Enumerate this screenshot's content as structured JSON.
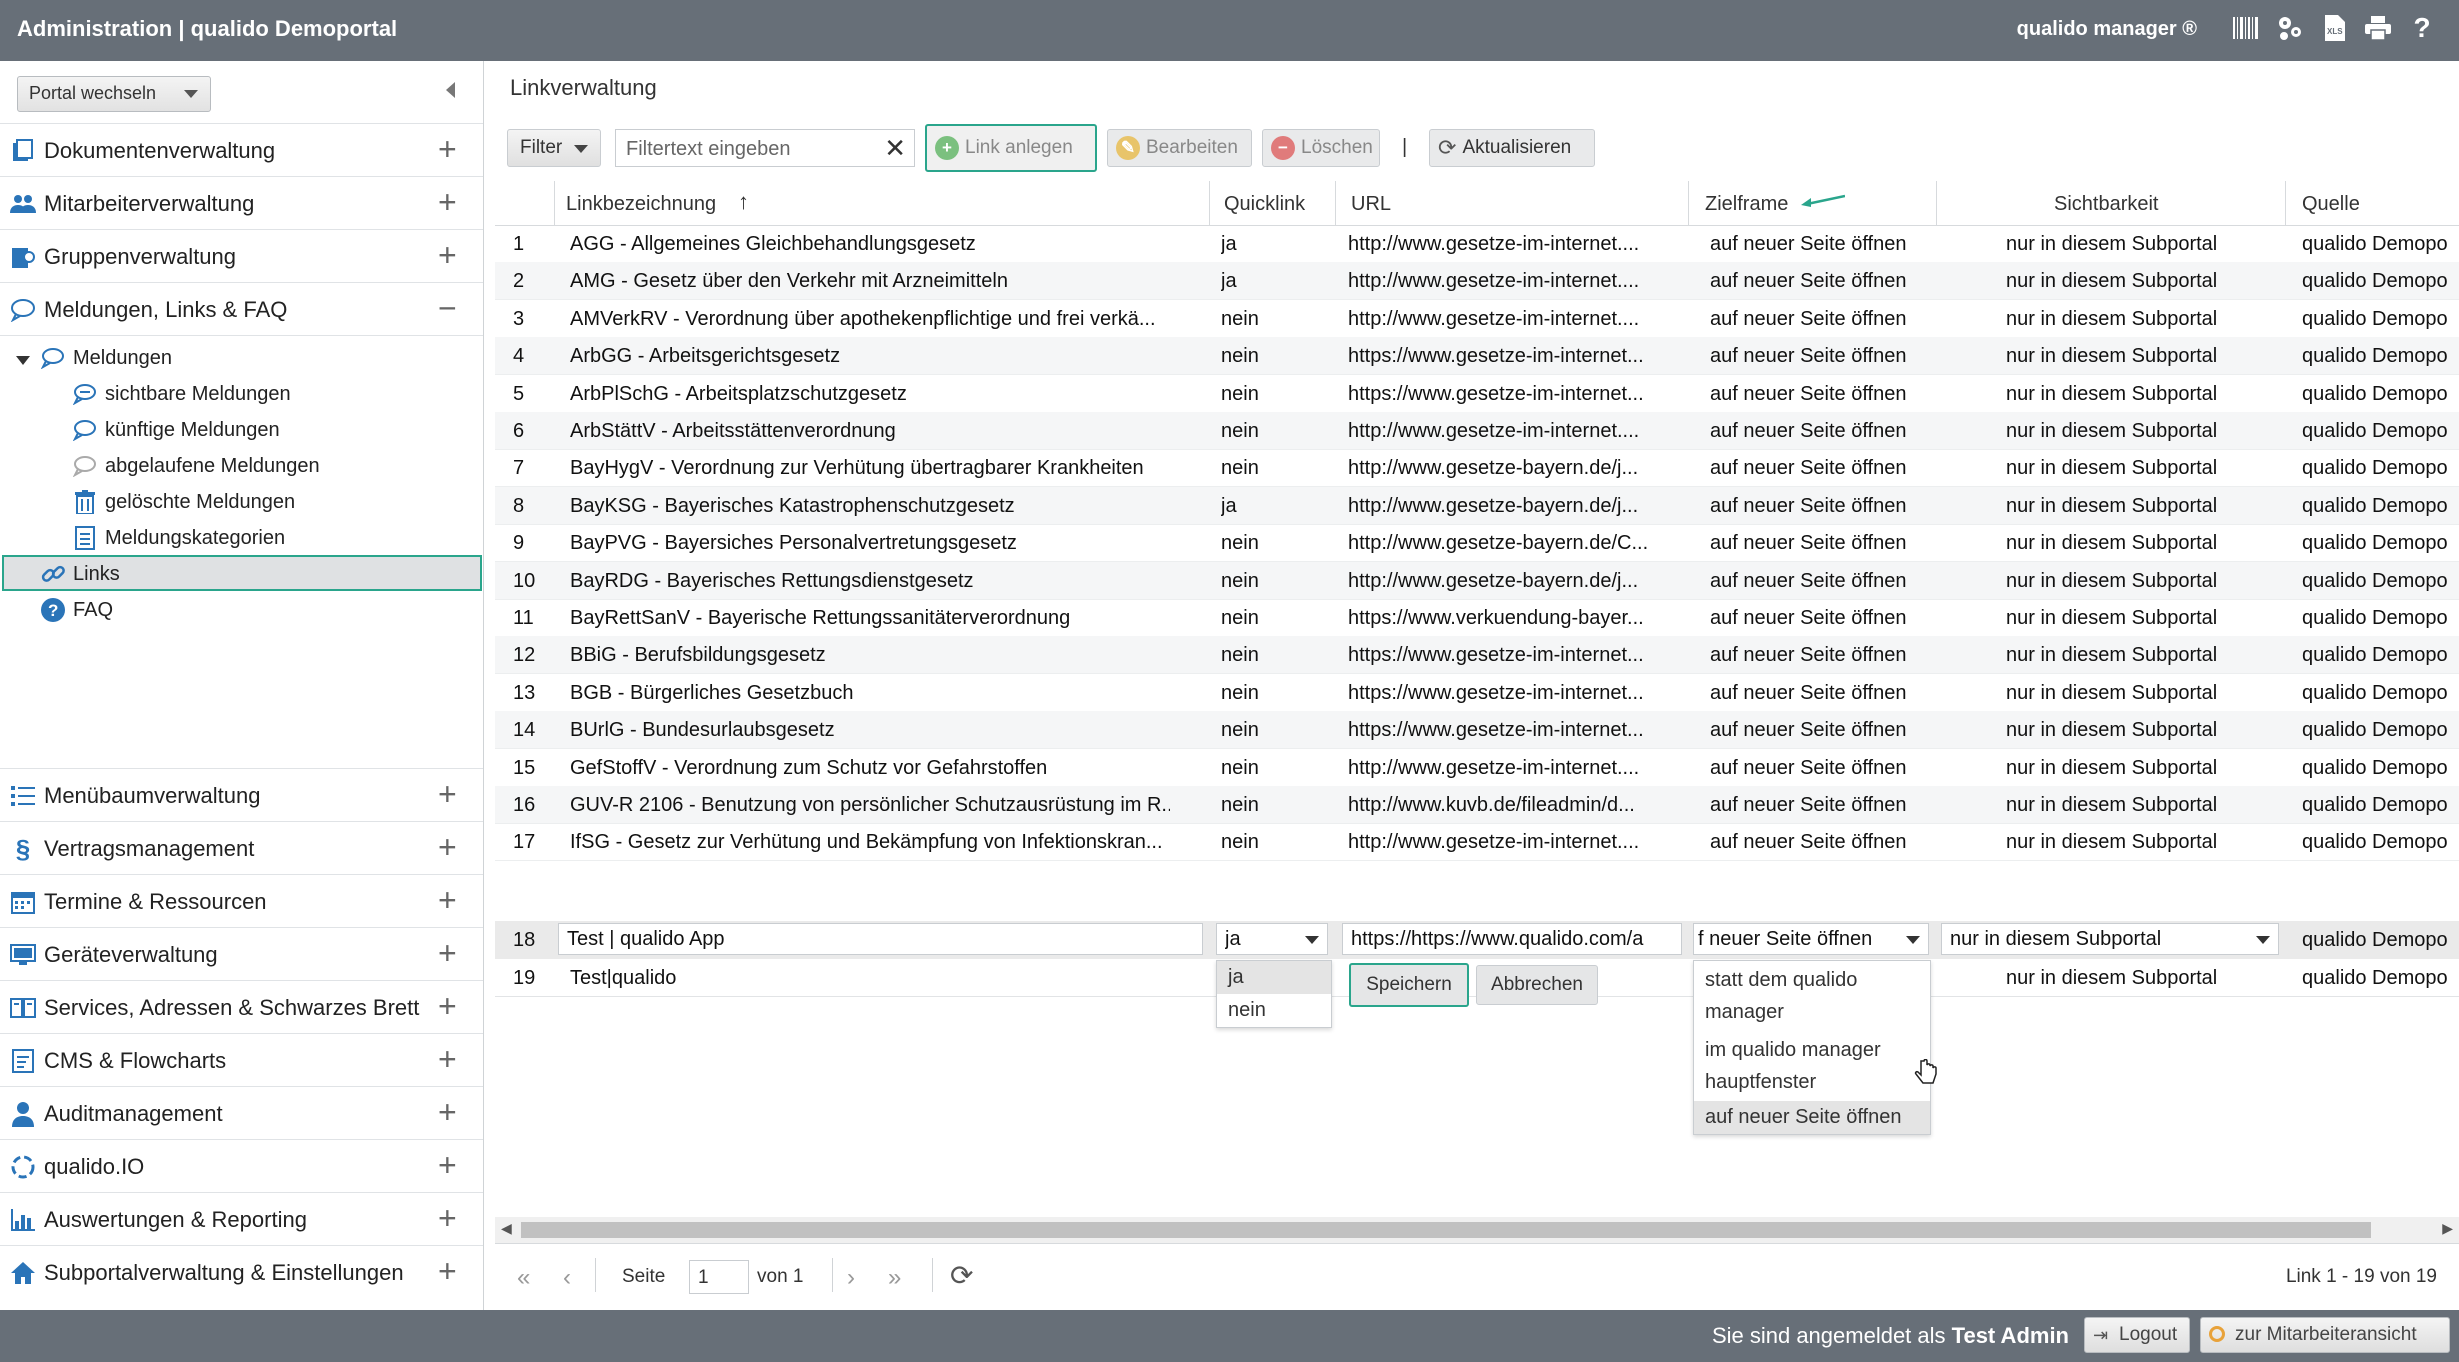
{
  "header": {
    "title": "Administration | qualido Demoportal",
    "brand": "qualido manager ®",
    "icons": [
      "barcode-icon",
      "sitemap-icon",
      "xls-export-icon",
      "print-icon",
      "help-icon"
    ]
  },
  "sidebar": {
    "portal_switch": "Portal wechseln",
    "sections_top": [
      {
        "label": "Dokumentenverwaltung",
        "icon": "documents-icon",
        "state": "+"
      },
      {
        "label": "Mitarbeiterverwaltung",
        "icon": "users-icon",
        "state": "+"
      },
      {
        "label": "Gruppenverwaltung",
        "icon": "group-icon",
        "state": "+"
      },
      {
        "label": "Meldungen, Links & FAQ",
        "icon": "messages-icon",
        "state": "−"
      }
    ],
    "tree": [
      {
        "label": "Meldungen",
        "icon": "messages-icon"
      },
      {
        "label": "sichtbare Meldungen",
        "icon": "message-icon"
      },
      {
        "label": "künftige Meldungen",
        "icon": "message-icon"
      },
      {
        "label": "abgelaufene Meldungen",
        "icon": "message-icon"
      },
      {
        "label": "gelöschte Meldungen",
        "icon": "trash-icon"
      },
      {
        "label": "Meldungskategorien",
        "icon": "categories-icon"
      },
      {
        "label": "Links",
        "icon": "link-icon"
      },
      {
        "label": "FAQ",
        "icon": "faq-icon"
      }
    ],
    "sections_bottom": [
      {
        "label": "Menübaumverwaltung",
        "icon": "menu-tree-icon",
        "state": "+"
      },
      {
        "label": "Vertragsmanagement",
        "icon": "paragraph-icon",
        "state": "+"
      },
      {
        "label": "Termine & Ressourcen",
        "icon": "calendar-icon",
        "state": "+"
      },
      {
        "label": "Geräteverwaltung",
        "icon": "devices-icon",
        "state": "+"
      },
      {
        "label": "Services, Adressen & Schwarzes Brett",
        "icon": "address-book-icon",
        "state": "+"
      },
      {
        "label": "CMS & Flowcharts",
        "icon": "cms-icon",
        "state": "+"
      },
      {
        "label": "Auditmanagement",
        "icon": "auditor-icon",
        "state": "+"
      },
      {
        "label": "qualido.IO",
        "icon": "qualido-io-icon",
        "state": "+"
      },
      {
        "label": "Auswertungen & Reporting",
        "icon": "chart-icon",
        "state": "+"
      },
      {
        "label": "Subportalverwaltung & Einstellungen",
        "icon": "home-icon",
        "state": "+"
      }
    ]
  },
  "main": {
    "title": "Linkverwaltung",
    "toolbar": {
      "filter": "Filter",
      "filter_placeholder": "Filtertext eingeben",
      "link_anlegen": "Link anlegen",
      "bearbeiten": "Bearbeiten",
      "loeschen": "Löschen",
      "separator": "|",
      "aktualisieren": "Aktualisieren"
    },
    "columns": [
      "Linkbezeichnung",
      "Quicklink",
      "URL",
      "Zielframe",
      "Sichtbarkeit",
      "Quelle"
    ],
    "rows": [
      {
        "n": "1",
        "name": "AGG - Allgemeines Gleichbehandlungsgesetz",
        "quick": "ja",
        "url": "http://www.gesetze-im-internet....",
        "frame": "auf neuer Seite öffnen",
        "vis": "nur in diesem Subportal",
        "src": "qualido Demopo"
      },
      {
        "n": "2",
        "name": "AMG - Gesetz über den Verkehr mit Arzneimitteln",
        "quick": "ja",
        "url": "http://www.gesetze-im-internet....",
        "frame": "auf neuer Seite öffnen",
        "vis": "nur in diesem Subportal",
        "src": "qualido Demopo"
      },
      {
        "n": "3",
        "name": "AMVerkRV - Verordnung über apothekenpflichtige und frei verkä...",
        "quick": "nein",
        "url": "http://www.gesetze-im-internet....",
        "frame": "auf neuer Seite öffnen",
        "vis": "nur in diesem Subportal",
        "src": "qualido Demopo"
      },
      {
        "n": "4",
        "name": "ArbGG - Arbeitsgerichtsgesetz",
        "quick": "nein",
        "url": "https://www.gesetze-im-internet...",
        "frame": "auf neuer Seite öffnen",
        "vis": "nur in diesem Subportal",
        "src": "qualido Demopo"
      },
      {
        "n": "5",
        "name": "ArbPlSchG - Arbeitsplatzschutzgesetz",
        "quick": "nein",
        "url": "https://www.gesetze-im-internet...",
        "frame": "auf neuer Seite öffnen",
        "vis": "nur in diesem Subportal",
        "src": "qualido Demopo"
      },
      {
        "n": "6",
        "name": "ArbStättV - Arbeitsstättenverordnung",
        "quick": "nein",
        "url": "http://www.gesetze-im-internet....",
        "frame": "auf neuer Seite öffnen",
        "vis": "nur in diesem Subportal",
        "src": "qualido Demopo"
      },
      {
        "n": "7",
        "name": "BayHygV - Verordnung zur Verhütung übertragbarer Krankheiten",
        "quick": "nein",
        "url": "http://www.gesetze-bayern.de/j...",
        "frame": "auf neuer Seite öffnen",
        "vis": "nur in diesem Subportal",
        "src": "qualido Demopo"
      },
      {
        "n": "8",
        "name": "BayKSG - Bayerisches Katastrophenschutzgesetz",
        "quick": "ja",
        "url": "http://www.gesetze-bayern.de/j...",
        "frame": "auf neuer Seite öffnen",
        "vis": "nur in diesem Subportal",
        "src": "qualido Demopo"
      },
      {
        "n": "9",
        "name": "BayPVG - Bayersiches Personalvertretungsgesetz",
        "quick": "nein",
        "url": "http://www.gesetze-bayern.de/C...",
        "frame": "auf neuer Seite öffnen",
        "vis": "nur in diesem Subportal",
        "src": "qualido Demopo"
      },
      {
        "n": "10",
        "name": "BayRDG - Bayerisches Rettungsdienstgesetz",
        "quick": "nein",
        "url": "http://www.gesetze-bayern.de/j...",
        "frame": "auf neuer Seite öffnen",
        "vis": "nur in diesem Subportal",
        "src": "qualido Demopo"
      },
      {
        "n": "11",
        "name": "BayRettSanV - Bayerische Rettungssanitäterverordnung",
        "quick": "nein",
        "url": "https://www.verkuendung-bayer...",
        "frame": "auf neuer Seite öffnen",
        "vis": "nur in diesem Subportal",
        "src": "qualido Demopo"
      },
      {
        "n": "12",
        "name": "BBiG - Berufsbildungsgesetz",
        "quick": "nein",
        "url": "https://www.gesetze-im-internet...",
        "frame": "auf neuer Seite öffnen",
        "vis": "nur in diesem Subportal",
        "src": "qualido Demopo"
      },
      {
        "n": "13",
        "name": "BGB - Bürgerliches Gesetzbuch",
        "quick": "nein",
        "url": "https://www.gesetze-im-internet...",
        "frame": "auf neuer Seite öffnen",
        "vis": "nur in diesem Subportal",
        "src": "qualido Demopo"
      },
      {
        "n": "14",
        "name": "BUrlG - Bundesurlaubsgesetz",
        "quick": "nein",
        "url": "https://www.gesetze-im-internet...",
        "frame": "auf neuer Seite öffnen",
        "vis": "nur in diesem Subportal",
        "src": "qualido Demopo"
      },
      {
        "n": "15",
        "name": "GefStoffV - Verordnung zum Schutz vor Gefahrstoffen",
        "quick": "nein",
        "url": "http://www.gesetze-im-internet....",
        "frame": "auf neuer Seite öffnen",
        "vis": "nur in diesem Subportal",
        "src": "qualido Demopo"
      },
      {
        "n": "16",
        "name": "GUV-R 2106 - Benutzung von persönlicher Schutzausrüstung im R...",
        "quick": "nein",
        "url": "http://www.kuvb.de/fileadmin/d...",
        "frame": "auf neuer Seite öffnen",
        "vis": "nur in diesem Subportal",
        "src": "qualido Demopo"
      },
      {
        "n": "17",
        "name": "IfSG - Gesetz zur Verhütung und Bekämpfung von Infektionskran...",
        "quick": "nein",
        "url": "http://www.gesetze-im-internet....",
        "frame": "auf neuer Seite öffnen",
        "vis": "nur in diesem Subportal",
        "src": "qualido Demopo"
      }
    ],
    "edit_row": {
      "n": "18",
      "name": "Test | qualido App",
      "quick": "ja",
      "url": "https://https://www.qualido.com/a",
      "frame": "f neuer Seite öffnen",
      "vis": "nur in diesem Subportal",
      "src": "qualido Demopo"
    },
    "row19": {
      "n": "19",
      "name": "Test|qualido",
      "vis": "nur in diesem Subportal",
      "src": "qualido Demopo"
    },
    "quick_options": [
      "ja",
      "nein"
    ],
    "frame_options": [
      "statt dem qualido manager",
      "im qualido manager hauptfenster",
      "auf neuer Seite öffnen"
    ],
    "save": "Speichern",
    "cancel": "Abbrechen",
    "pager": {
      "seite": "Seite",
      "page": "1",
      "von": "von 1",
      "info": "Link 1 - 19 von 19"
    }
  },
  "footer": {
    "logged_prefix": "Sie sind angemeldet als",
    "user": "Test Admin",
    "logout": "Logout",
    "employee_view": "zur Mitarbeiteransicht"
  },
  "colors": {
    "accent": "#2aa58c",
    "bar": "#676f78",
    "icon": "#2a74b8"
  }
}
